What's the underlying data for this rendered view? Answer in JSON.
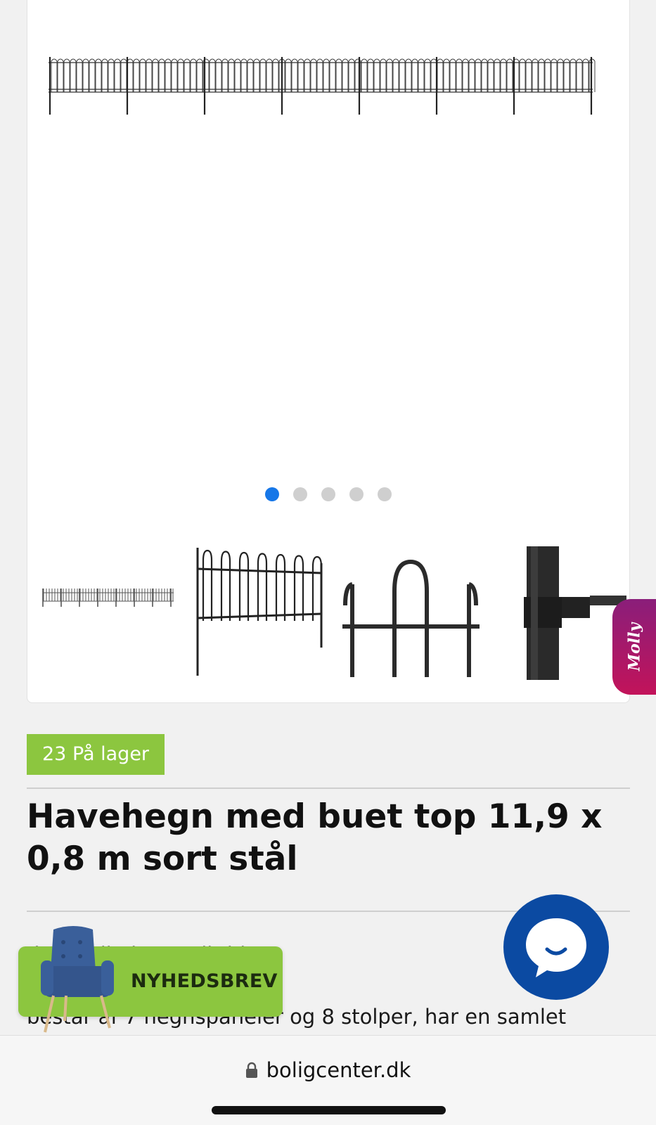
{
  "carousel": {
    "slide_count": 5,
    "active_index": 0,
    "thumbnails": [
      "fence-full",
      "fence-panel",
      "fence-arches-closeup",
      "fence-post-clamp"
    ]
  },
  "molly_tab": {
    "label": "Molly"
  },
  "stock_badge": {
    "label": "23 På lager"
  },
  "product": {
    "title": "Havehegn med buet top 11,9 x 0,8 m sort stål",
    "description": "dt om din have, dit hj\nres dekorative hegn i s\nbestar af 7 hegnspaneler og 8 stolper, har en samlet"
  },
  "newsletter": {
    "label": "NYHEDSBREV"
  },
  "chat": {
    "icon": "chat-bubble-icon"
  },
  "browser": {
    "url": "boligcenter.dk",
    "icon": "lock-icon"
  },
  "colors": {
    "accent_green": "#8cc63f",
    "active_dot": "#1677e8",
    "chat_blue": "#0b4aa2",
    "molly_start": "#8a1e7a",
    "molly_end": "#c2135a"
  }
}
